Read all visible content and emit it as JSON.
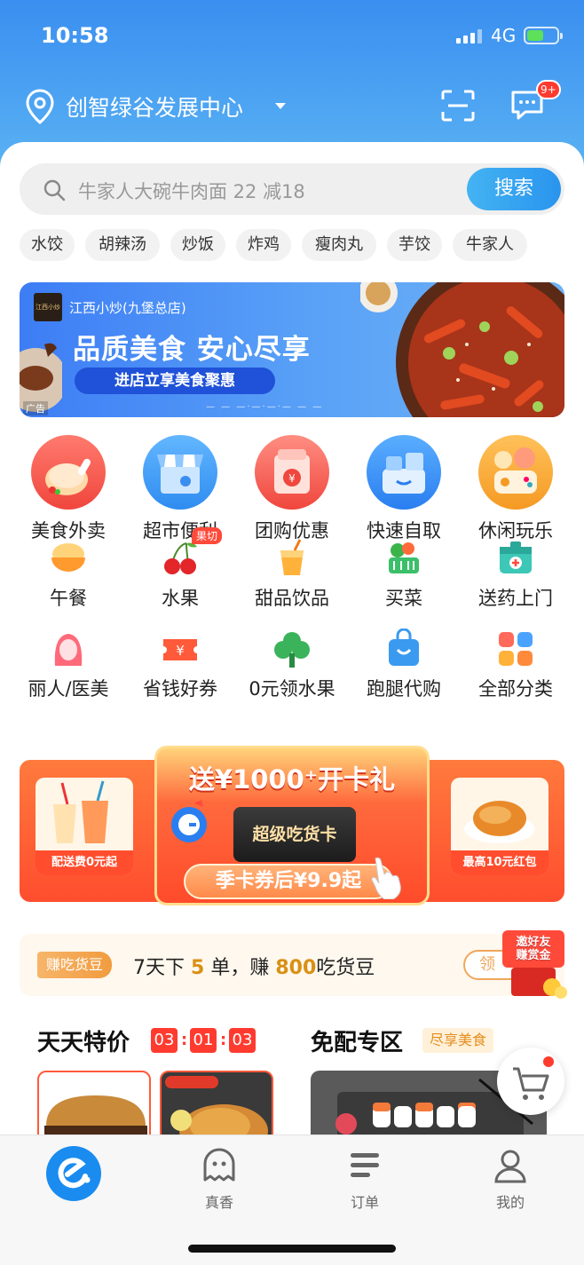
{
  "status_bar": {
    "time": "10:58",
    "network": "4G"
  },
  "location": {
    "label": "创智绿谷发展中心"
  },
  "messages": {
    "badge": "9+"
  },
  "search": {
    "placeholder": "牛家人大碗牛肉面 22 减18",
    "button": "搜索"
  },
  "hot_chips": [
    "水饺",
    "胡辣汤",
    "炒饭",
    "炸鸡",
    "瘦肉丸",
    "芋饺",
    "牛家人"
  ],
  "ad_banner": {
    "store": "江西小炒(九堡总店)",
    "logo_text": "江西小炒",
    "title": "品质美食 安心尽享",
    "subtitle": "进店立享美食聚惠",
    "ad_label": "广告"
  },
  "categories_main": [
    {
      "label": "美食外卖",
      "icon": "roast-chicken-icon"
    },
    {
      "label": "超市便利",
      "icon": "store-icon"
    },
    {
      "label": "团购优惠",
      "icon": "coupon-bag-icon"
    },
    {
      "label": "快速自取",
      "icon": "pickup-box-icon"
    },
    {
      "label": "休闲玩乐",
      "icon": "game-icon"
    }
  ],
  "categories_row2": [
    {
      "label": "午餐",
      "icon": "rice-bowl-icon"
    },
    {
      "label": "水果",
      "icon": "cherry-icon",
      "tag": "果切"
    },
    {
      "label": "甜品饮品",
      "icon": "drink-icon"
    },
    {
      "label": "买菜",
      "icon": "vegetable-basket-icon"
    },
    {
      "label": "送药上门",
      "icon": "medicine-box-icon"
    }
  ],
  "categories_row3": [
    {
      "label": "丽人/医美",
      "icon": "beauty-icon"
    },
    {
      "label": "省钱好券",
      "icon": "ticket-icon"
    },
    {
      "label": "0元领水果",
      "icon": "tree-icon"
    },
    {
      "label": "跑腿代购",
      "icon": "shopping-bag-icon"
    },
    {
      "label": "全部分类",
      "icon": "all-categories-icon"
    }
  ],
  "promo": {
    "title": "送¥1000⁺开卡礼",
    "card": "超级吃货卡",
    "price": "季卡券后¥9.9起",
    "left_caption": "配送费0元起",
    "right_caption": "最高10元红包"
  },
  "bean_bar": {
    "tag": "赚吃货豆",
    "text_pre": "7天下",
    "orders": "5",
    "text_mid": "单，赚",
    "beans": "800",
    "text_post": "吃货豆",
    "button": "领",
    "gift_line1": "邀好友",
    "gift_line2": "赚赏金"
  },
  "section_left": {
    "title": "天天特价",
    "countdown": [
      "03",
      "01",
      "03"
    ]
  },
  "section_right": {
    "title": "免配专区",
    "tag": "尽享美食"
  },
  "tabbar": {
    "tabs": [
      {
        "label": "",
        "icon": "eleme-home-icon"
      },
      {
        "label": "真香",
        "icon": "ghost-icon"
      },
      {
        "label": "订单",
        "icon": "order-list-icon"
      },
      {
        "label": "我的",
        "icon": "user-icon"
      }
    ]
  },
  "colors": {
    "brand_blue": "#1a8cf0",
    "promo_red": "#ff4b2b",
    "countdown_red": "#ff3b30"
  }
}
